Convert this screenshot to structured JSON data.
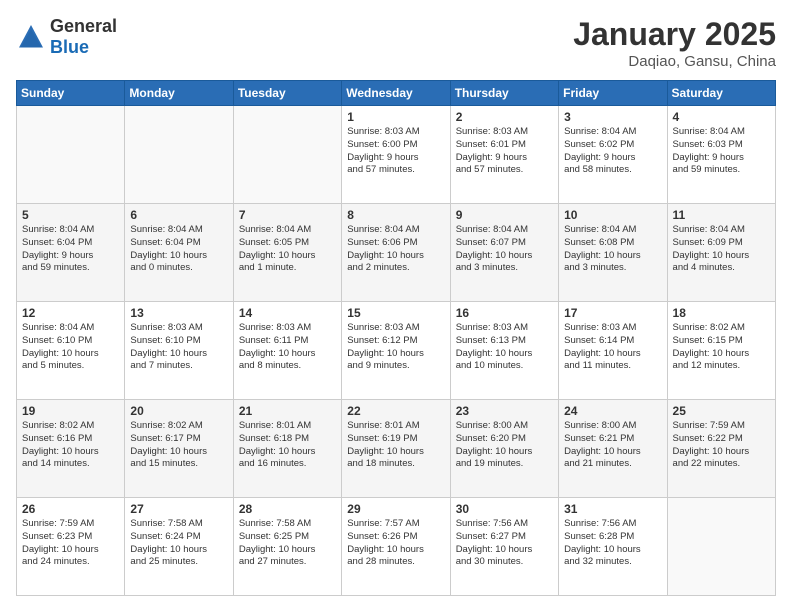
{
  "header": {
    "logo_general": "General",
    "logo_blue": "Blue",
    "title": "January 2025",
    "subtitle": "Daqiao, Gansu, China"
  },
  "weekdays": [
    "Sunday",
    "Monday",
    "Tuesday",
    "Wednesday",
    "Thursday",
    "Friday",
    "Saturday"
  ],
  "weeks": [
    [
      {
        "day": "",
        "info": ""
      },
      {
        "day": "",
        "info": ""
      },
      {
        "day": "",
        "info": ""
      },
      {
        "day": "1",
        "info": "Sunrise: 8:03 AM\nSunset: 6:00 PM\nDaylight: 9 hours\nand 57 minutes."
      },
      {
        "day": "2",
        "info": "Sunrise: 8:03 AM\nSunset: 6:01 PM\nDaylight: 9 hours\nand 57 minutes."
      },
      {
        "day": "3",
        "info": "Sunrise: 8:04 AM\nSunset: 6:02 PM\nDaylight: 9 hours\nand 58 minutes."
      },
      {
        "day": "4",
        "info": "Sunrise: 8:04 AM\nSunset: 6:03 PM\nDaylight: 9 hours\nand 59 minutes."
      }
    ],
    [
      {
        "day": "5",
        "info": "Sunrise: 8:04 AM\nSunset: 6:04 PM\nDaylight: 9 hours\nand 59 minutes."
      },
      {
        "day": "6",
        "info": "Sunrise: 8:04 AM\nSunset: 6:04 PM\nDaylight: 10 hours\nand 0 minutes."
      },
      {
        "day": "7",
        "info": "Sunrise: 8:04 AM\nSunset: 6:05 PM\nDaylight: 10 hours\nand 1 minute."
      },
      {
        "day": "8",
        "info": "Sunrise: 8:04 AM\nSunset: 6:06 PM\nDaylight: 10 hours\nand 2 minutes."
      },
      {
        "day": "9",
        "info": "Sunrise: 8:04 AM\nSunset: 6:07 PM\nDaylight: 10 hours\nand 3 minutes."
      },
      {
        "day": "10",
        "info": "Sunrise: 8:04 AM\nSunset: 6:08 PM\nDaylight: 10 hours\nand 3 minutes."
      },
      {
        "day": "11",
        "info": "Sunrise: 8:04 AM\nSunset: 6:09 PM\nDaylight: 10 hours\nand 4 minutes."
      }
    ],
    [
      {
        "day": "12",
        "info": "Sunrise: 8:04 AM\nSunset: 6:10 PM\nDaylight: 10 hours\nand 5 minutes."
      },
      {
        "day": "13",
        "info": "Sunrise: 8:03 AM\nSunset: 6:10 PM\nDaylight: 10 hours\nand 7 minutes."
      },
      {
        "day": "14",
        "info": "Sunrise: 8:03 AM\nSunset: 6:11 PM\nDaylight: 10 hours\nand 8 minutes."
      },
      {
        "day": "15",
        "info": "Sunrise: 8:03 AM\nSunset: 6:12 PM\nDaylight: 10 hours\nand 9 minutes."
      },
      {
        "day": "16",
        "info": "Sunrise: 8:03 AM\nSunset: 6:13 PM\nDaylight: 10 hours\nand 10 minutes."
      },
      {
        "day": "17",
        "info": "Sunrise: 8:03 AM\nSunset: 6:14 PM\nDaylight: 10 hours\nand 11 minutes."
      },
      {
        "day": "18",
        "info": "Sunrise: 8:02 AM\nSunset: 6:15 PM\nDaylight: 10 hours\nand 12 minutes."
      }
    ],
    [
      {
        "day": "19",
        "info": "Sunrise: 8:02 AM\nSunset: 6:16 PM\nDaylight: 10 hours\nand 14 minutes."
      },
      {
        "day": "20",
        "info": "Sunrise: 8:02 AM\nSunset: 6:17 PM\nDaylight: 10 hours\nand 15 minutes."
      },
      {
        "day": "21",
        "info": "Sunrise: 8:01 AM\nSunset: 6:18 PM\nDaylight: 10 hours\nand 16 minutes."
      },
      {
        "day": "22",
        "info": "Sunrise: 8:01 AM\nSunset: 6:19 PM\nDaylight: 10 hours\nand 18 minutes."
      },
      {
        "day": "23",
        "info": "Sunrise: 8:00 AM\nSunset: 6:20 PM\nDaylight: 10 hours\nand 19 minutes."
      },
      {
        "day": "24",
        "info": "Sunrise: 8:00 AM\nSunset: 6:21 PM\nDaylight: 10 hours\nand 21 minutes."
      },
      {
        "day": "25",
        "info": "Sunrise: 7:59 AM\nSunset: 6:22 PM\nDaylight: 10 hours\nand 22 minutes."
      }
    ],
    [
      {
        "day": "26",
        "info": "Sunrise: 7:59 AM\nSunset: 6:23 PM\nDaylight: 10 hours\nand 24 minutes."
      },
      {
        "day": "27",
        "info": "Sunrise: 7:58 AM\nSunset: 6:24 PM\nDaylight: 10 hours\nand 25 minutes."
      },
      {
        "day": "28",
        "info": "Sunrise: 7:58 AM\nSunset: 6:25 PM\nDaylight: 10 hours\nand 27 minutes."
      },
      {
        "day": "29",
        "info": "Sunrise: 7:57 AM\nSunset: 6:26 PM\nDaylight: 10 hours\nand 28 minutes."
      },
      {
        "day": "30",
        "info": "Sunrise: 7:56 AM\nSunset: 6:27 PM\nDaylight: 10 hours\nand 30 minutes."
      },
      {
        "day": "31",
        "info": "Sunrise: 7:56 AM\nSunset: 6:28 PM\nDaylight: 10 hours\nand 32 minutes."
      },
      {
        "day": "",
        "info": ""
      }
    ]
  ]
}
